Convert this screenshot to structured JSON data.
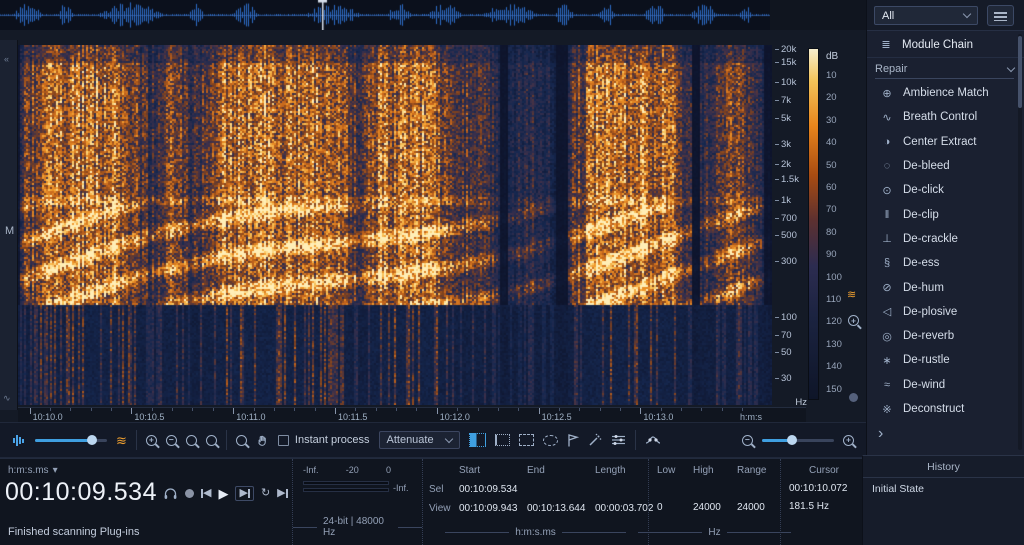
{
  "colors": {
    "bg": "#10151f",
    "panel": "#141a26",
    "sidebar": "#1a2030",
    "accent": "#3f9fe0",
    "hot": "#f0a030",
    "text": "#dfe6f0",
    "muted": "#8d9ab0"
  },
  "icons": {
    "blend_wave": "≋",
    "vertical_wave": "≋",
    "loop": "↻",
    "play": "▶",
    "prev": "◀",
    "next": "▶",
    "goto_end": "▶",
    "format_caret": "▾",
    "module_chain_glyph": "≣",
    "zoom_in_sign": "+",
    "zoom_out_sign": "−"
  },
  "sidebar": {
    "filter_value": "All",
    "module_chain_label": "Module Chain",
    "section_label": "Repair",
    "expand_arrow": "›",
    "items": [
      {
        "label": "Ambience Match",
        "glyph": "⊕",
        "icon": "ambience-match-icon"
      },
      {
        "label": "Breath Control",
        "glyph": "∿",
        "icon": "breath-control-icon"
      },
      {
        "label": "Center Extract",
        "glyph": "◑",
        "icon": "center-extract-icon"
      },
      {
        "label": "De-bleed",
        "glyph": "◌",
        "icon": "de-bleed-icon"
      },
      {
        "label": "De-click",
        "glyph": "⊙",
        "icon": "de-click-icon"
      },
      {
        "label": "De-clip",
        "glyph": "‖",
        "icon": "de-clip-icon"
      },
      {
        "label": "De-crackle",
        "glyph": "⊥",
        "icon": "de-crackle-icon"
      },
      {
        "label": "De-ess",
        "glyph": "§",
        "icon": "de-ess-icon"
      },
      {
        "label": "De-hum",
        "glyph": "⊘",
        "icon": "de-hum-icon"
      },
      {
        "label": "De-plosive",
        "glyph": "◁",
        "icon": "de-plosive-icon"
      },
      {
        "label": "De-reverb",
        "glyph": "◎",
        "icon": "de-reverb-icon"
      },
      {
        "label": "De-rustle",
        "glyph": "∗",
        "icon": "de-rustle-icon"
      },
      {
        "label": "De-wind",
        "glyph": "≈",
        "icon": "de-wind-icon"
      },
      {
        "label": "Deconstruct",
        "glyph": "※",
        "icon": "deconstruct-icon"
      }
    ]
  },
  "main": {
    "channel_label": "M",
    "freq_axis": {
      "ticks": [
        "20k",
        "15k",
        "10k",
        "7k",
        "5k",
        "3k",
        "2k",
        "1.5k",
        "1k",
        "700",
        "500",
        "300",
        "100",
        "70",
        "50",
        "30"
      ],
      "unit": "Hz"
    },
    "db_axis": {
      "label": "dB",
      "ticks": [
        "10",
        "20",
        "30",
        "40",
        "50",
        "60",
        "70",
        "80",
        "90",
        "100",
        "110",
        "120",
        "130",
        "140",
        "150"
      ]
    },
    "time_ruler": {
      "ticks": [
        "10:10.0",
        "10:10.5",
        "10:11.0",
        "10:11.5",
        "10:12.0",
        "10:12.5",
        "10:13.0"
      ],
      "unit": "h:m:s"
    }
  },
  "toolbar": {
    "instant_process_label": "Instant process",
    "process_mode": "Attenuate"
  },
  "transport": {
    "format_label": "h:m:s.ms",
    "time": "00:10:09.534",
    "status": "Finished scanning Plug-ins"
  },
  "meter": {
    "scale": [
      "-Inf.",
      "-20",
      "0"
    ],
    "readout": "-Inf.",
    "format": "24-bit | 48000 Hz"
  },
  "selection": {
    "col_headers": [
      "Start",
      "End",
      "Length"
    ],
    "row_sel_label": "Sel",
    "row_view_label": "View",
    "sel": {
      "start": "00:10:09.534",
      "end": "",
      "length": ""
    },
    "view": {
      "start": "00:10:09.943",
      "end": "00:10:13.644",
      "length": "00:00:03.702"
    },
    "unit": "h:m:s.ms"
  },
  "freq_selection": {
    "col_headers": [
      "Low",
      "High",
      "Range"
    ],
    "low": "0",
    "high": "24000",
    "range": "24000",
    "unit": "Hz"
  },
  "cursor": {
    "label": "Cursor",
    "time": "00:10:10.072",
    "freq": "181.5 Hz"
  },
  "history": {
    "title": "History",
    "items": [
      "Initial State"
    ]
  }
}
